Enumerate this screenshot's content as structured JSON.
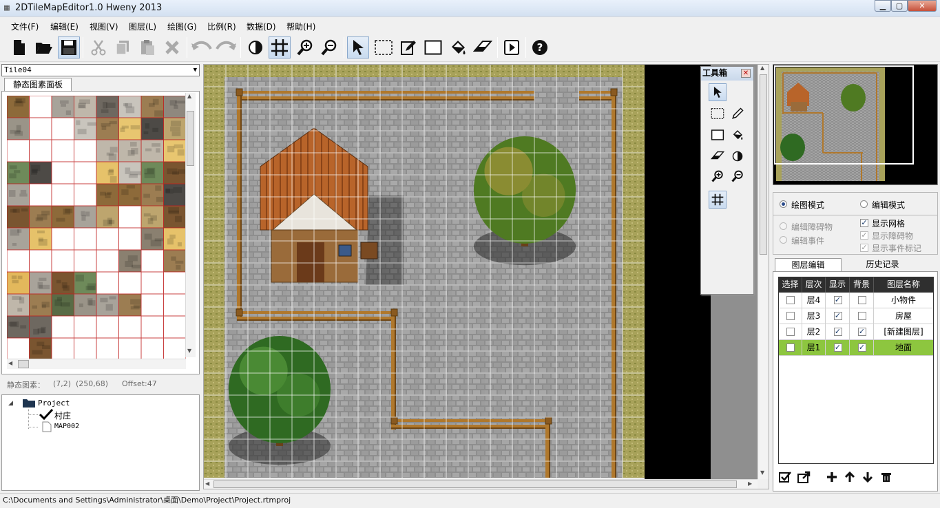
{
  "window": {
    "title": "2DTileMapEditor1.0 Hweny 2013",
    "controls": [
      "minimize",
      "maximize",
      "close"
    ]
  },
  "menu": [
    {
      "label": "文件(F)"
    },
    {
      "label": "编辑(E)"
    },
    {
      "label": "视图(V)"
    },
    {
      "label": "图层(L)"
    },
    {
      "label": "绘图(G)"
    },
    {
      "label": "比例(R)"
    },
    {
      "label": "数据(D)"
    },
    {
      "label": "帮助(H)"
    }
  ],
  "toolbar": {
    "buttons": [
      {
        "icon": "new-file-icon",
        "enabled": true
      },
      {
        "icon": "open-folder-icon",
        "enabled": true
      },
      {
        "icon": "save-icon",
        "enabled": true,
        "active": true
      },
      {
        "icon": "cut-icon",
        "enabled": false
      },
      {
        "icon": "copy-icon",
        "enabled": false
      },
      {
        "icon": "paste-icon",
        "enabled": false
      },
      {
        "icon": "delete-icon",
        "enabled": false
      },
      {
        "icon": "undo-icon",
        "enabled": false
      },
      {
        "icon": "redo-icon",
        "enabled": false
      },
      {
        "icon": "contrast-icon",
        "enabled": true
      },
      {
        "icon": "grid-icon",
        "enabled": true,
        "active": true
      },
      {
        "icon": "zoom-in-icon",
        "enabled": true
      },
      {
        "icon": "zoom-out-icon",
        "enabled": true
      },
      {
        "icon": "pointer-icon",
        "enabled": true,
        "active": true
      },
      {
        "icon": "marquee-select-icon",
        "enabled": true
      },
      {
        "icon": "pencil-icon",
        "enabled": true
      },
      {
        "icon": "rectangle-icon",
        "enabled": true
      },
      {
        "icon": "fill-bucket-icon",
        "enabled": true
      },
      {
        "icon": "eraser-icon",
        "enabled": true
      },
      {
        "icon": "play-icon",
        "enabled": true
      },
      {
        "icon": "help-icon",
        "enabled": true
      }
    ]
  },
  "tileset": {
    "selected": "Tile04",
    "tab_label": "静态图素面板",
    "status_label": "静态图素：",
    "status_cell": "(7,2)",
    "status_pixel": "(250,68)",
    "status_offset": "Offset:47"
  },
  "project_tree": {
    "root": "Project",
    "children": [
      {
        "label": "村庄",
        "checked": true
      },
      {
        "label": "MAP002",
        "checked": false
      }
    ]
  },
  "toolbox": {
    "title": "工具箱",
    "tools": [
      "pointer-icon",
      "marquee-select-icon",
      "pencil-icon",
      "rectangle-icon",
      "fill-bucket-icon",
      "eraser-icon",
      "contrast-icon",
      "zoom-in-icon",
      "zoom-out-icon",
      "grid-icon"
    ]
  },
  "modes": {
    "draw_mode": "绘图模式",
    "edit_mode": "编辑模式",
    "selected": "draw_mode"
  },
  "options": {
    "edit_obstacle": "编辑障碍物",
    "edit_event": "编辑事件",
    "show_grid": "显示网格",
    "show_obstacle": "显示障碍物",
    "show_event_marker": "显示事件标记"
  },
  "panel_tabs": {
    "layer_edit": "图层编辑",
    "history": "历史记录"
  },
  "layer_table": {
    "headers": [
      "选择",
      "层次",
      "显示",
      "背景",
      "图层名称"
    ],
    "rows": [
      {
        "level": "层4",
        "visible": true,
        "background": false,
        "name": "小物件",
        "selected": false
      },
      {
        "level": "层3",
        "visible": true,
        "background": false,
        "name": "房屋",
        "selected": false
      },
      {
        "level": "层2",
        "visible": true,
        "background": true,
        "name": "[新建图层]",
        "selected": false
      },
      {
        "level": "层1",
        "visible": true,
        "background": true,
        "name": "地面",
        "selected": true
      }
    ],
    "highlight_color": "#8dc63f"
  },
  "layer_buttons": [
    "check-all-icon",
    "export-icon",
    "add-icon",
    "move-up-icon",
    "move-down-icon",
    "trash-icon"
  ],
  "status_bar": {
    "path": "C:\\Documents and Settings\\Administrator\\桌面\\Demo\\Project\\Project.rtmproj"
  }
}
